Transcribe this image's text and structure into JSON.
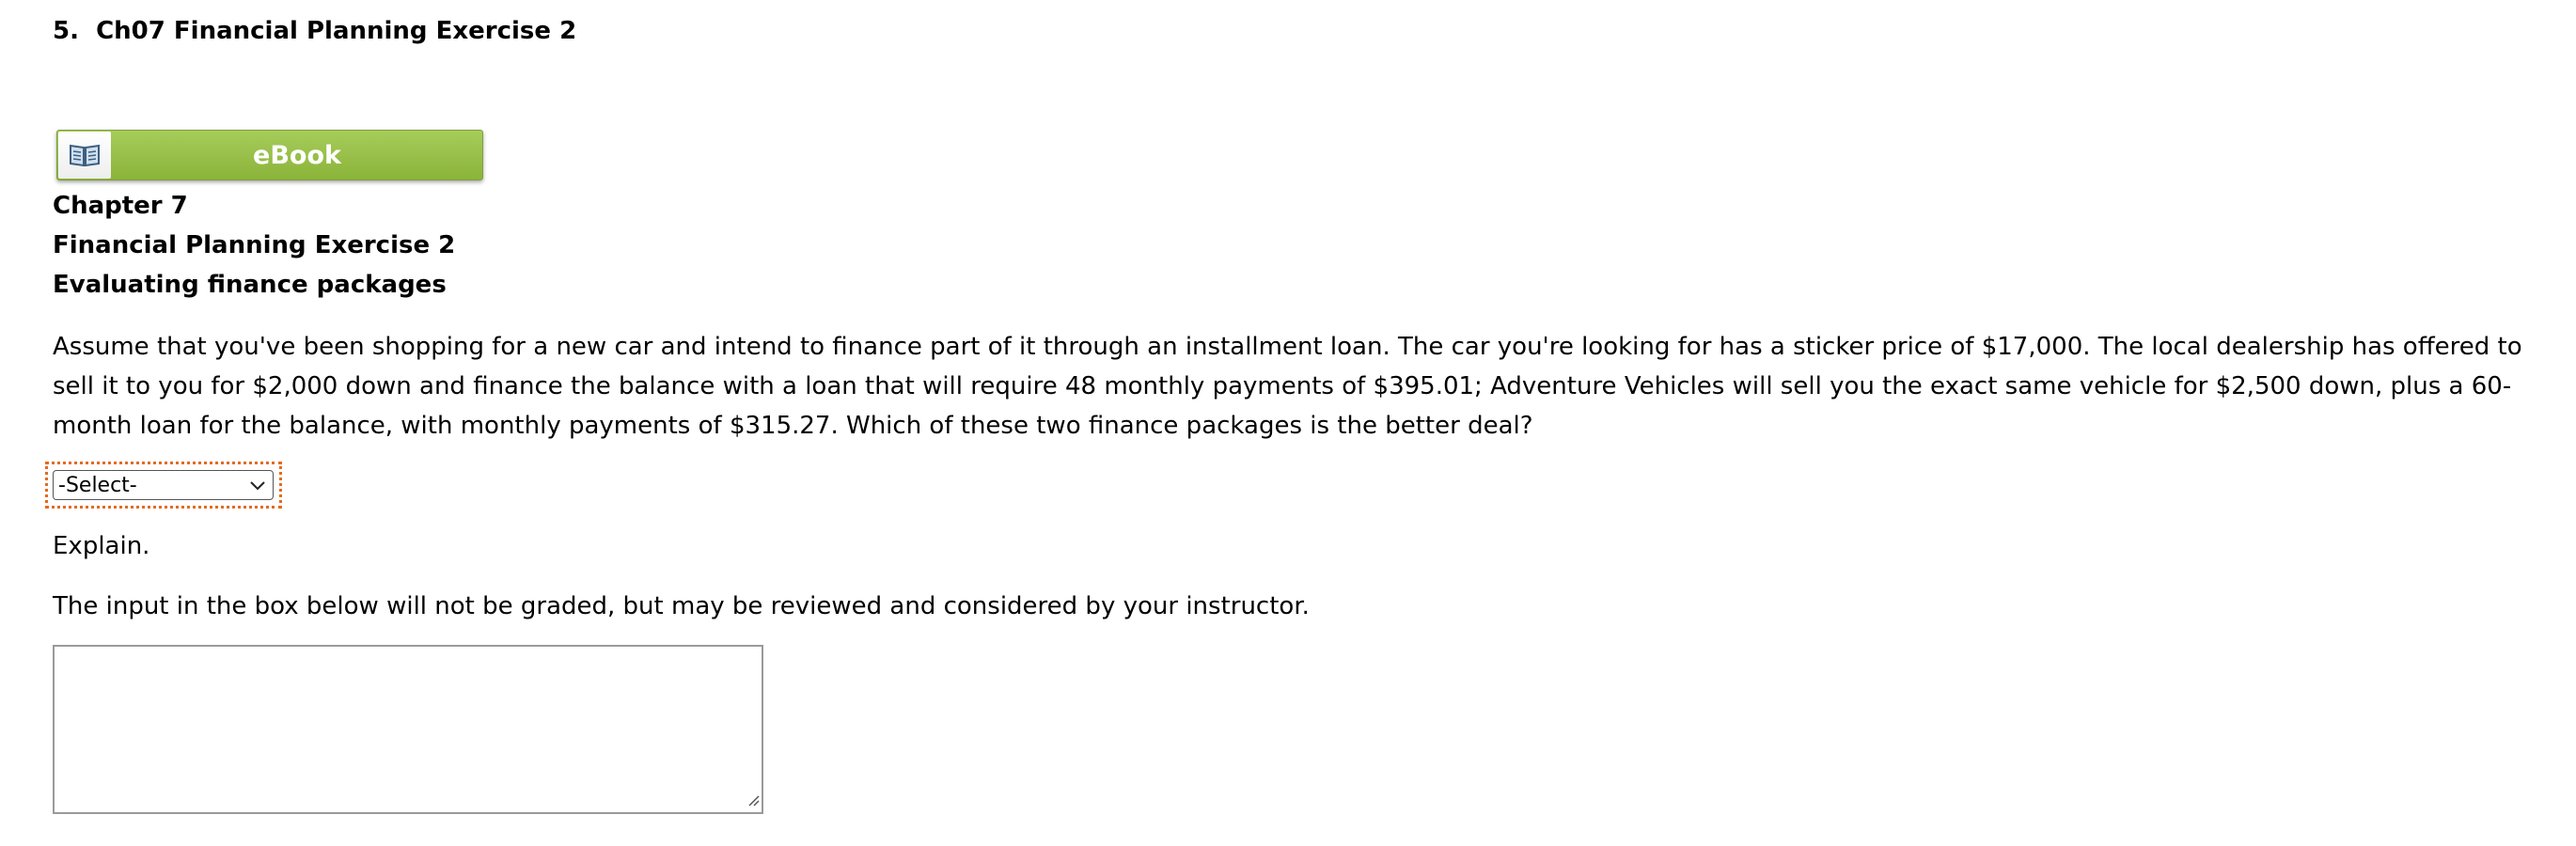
{
  "question": {
    "number": "5.",
    "title": "Ch07 Financial Planning Exercise 2"
  },
  "ebook": {
    "label": "eBook",
    "icon": "book-icon",
    "accent_color": "#8bb43a"
  },
  "headings": {
    "chapter": "Chapter 7",
    "exercise": "Financial Planning Exercise 2",
    "topic": "Evaluating finance packages"
  },
  "problem": {
    "text": "Assume that you've been shopping for a new car and intend to finance part of it through an installment loan. The car you're looking for has a sticker price of $17,000. The local dealership has offered to sell it to you for $2,000 down and finance the balance with a loan that will require 48 monthly payments of $395.01; Adventure Vehicles will sell you the exact same vehicle for $2,500 down, plus a 60-month loan for the balance, with monthly payments of $315.27. Which of these two finance packages is the better deal?"
  },
  "answer_select": {
    "selected": "-Select-",
    "focus_color": "#e36b1f"
  },
  "explain": {
    "label": "Explain.",
    "note": "The input in the box below will not be graded, but may be reviewed and considered by your instructor.",
    "value": ""
  }
}
